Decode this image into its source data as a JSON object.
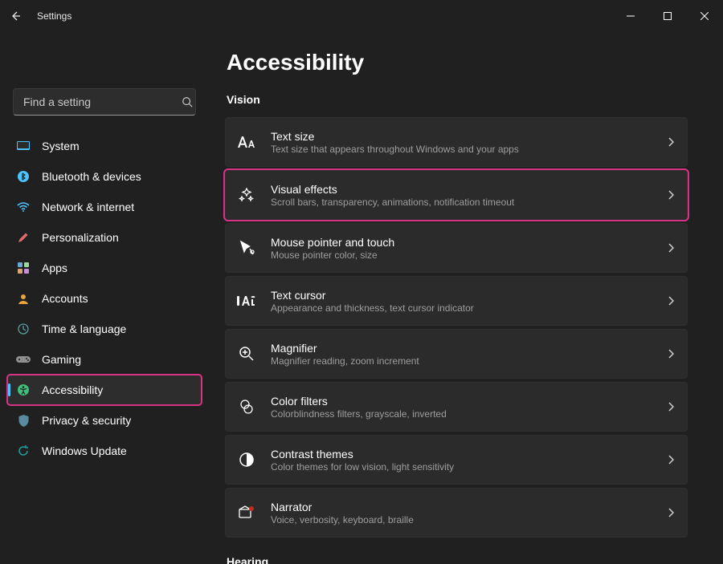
{
  "window": {
    "title": "Settings"
  },
  "search": {
    "placeholder": "Find a setting"
  },
  "sidebar": {
    "items": [
      {
        "id": "system",
        "label": "System",
        "icon_name": "system-icon",
        "icon_color": "#4cc2ff",
        "active": false,
        "highlight": false
      },
      {
        "id": "bluetooth",
        "label": "Bluetooth & devices",
        "icon_name": "bluetooth-icon",
        "icon_color": "#4cc2ff",
        "active": false,
        "highlight": false
      },
      {
        "id": "network",
        "label": "Network & internet",
        "icon_name": "wifi-icon",
        "icon_color": "#4cc2ff",
        "active": false,
        "highlight": false
      },
      {
        "id": "personalization",
        "label": "Personalization",
        "icon_name": "pen-icon",
        "icon_color": "#e06b6b",
        "active": false,
        "highlight": false
      },
      {
        "id": "apps",
        "label": "Apps",
        "icon_name": "apps-icon",
        "icon_color": "#8f8f8f",
        "active": false,
        "highlight": false
      },
      {
        "id": "accounts",
        "label": "Accounts",
        "icon_name": "accounts-icon",
        "icon_color": "#e8a33d",
        "active": false,
        "highlight": false
      },
      {
        "id": "time-language",
        "label": "Time & language",
        "icon_name": "time-language-icon",
        "icon_color": "#5aa0a0",
        "active": false,
        "highlight": false
      },
      {
        "id": "gaming",
        "label": "Gaming",
        "icon_name": "gaming-icon",
        "icon_color": "#8f8f8f",
        "active": false,
        "highlight": false
      },
      {
        "id": "accessibility",
        "label": "Accessibility",
        "icon_name": "accessibility-icon",
        "icon_color": "#3fbf7a",
        "active": true,
        "highlight": true
      },
      {
        "id": "privacy",
        "label": "Privacy & security",
        "icon_name": "shield-icon",
        "icon_color": "#5a8aa0",
        "active": false,
        "highlight": false
      },
      {
        "id": "windows-update",
        "label": "Windows Update",
        "icon_name": "windows-update-icon",
        "icon_color": "#1aa0a0",
        "active": false,
        "highlight": false
      }
    ]
  },
  "page": {
    "title": "Accessibility",
    "section1": {
      "title": "Vision"
    },
    "section2": {
      "title": "Hearing"
    },
    "cards": [
      {
        "id": "text-size",
        "icon_name": "text-size-icon",
        "title": "Text size",
        "subtitle": "Text size that appears throughout Windows and your apps",
        "highlight": false
      },
      {
        "id": "visual-effects",
        "icon_name": "visual-effects-icon",
        "title": "Visual effects",
        "subtitle": "Scroll bars, transparency, animations, notification timeout",
        "highlight": true
      },
      {
        "id": "mouse-pointer",
        "icon_name": "mouse-pointer-icon",
        "title": "Mouse pointer and touch",
        "subtitle": "Mouse pointer color, size",
        "highlight": false
      },
      {
        "id": "text-cursor",
        "icon_name": "text-cursor-icon",
        "title": "Text cursor",
        "subtitle": "Appearance and thickness, text cursor indicator",
        "highlight": false
      },
      {
        "id": "magnifier",
        "icon_name": "magnifier-icon",
        "title": "Magnifier",
        "subtitle": "Magnifier reading, zoom increment",
        "highlight": false
      },
      {
        "id": "color-filters",
        "icon_name": "color-filters-icon",
        "title": "Color filters",
        "subtitle": "Colorblindness filters, grayscale, inverted",
        "highlight": false
      },
      {
        "id": "contrast-themes",
        "icon_name": "contrast-icon",
        "title": "Contrast themes",
        "subtitle": "Color themes for low vision, light sensitivity",
        "highlight": false
      },
      {
        "id": "narrator",
        "icon_name": "narrator-icon",
        "title": "Narrator",
        "subtitle": "Voice, verbosity, keyboard, braille",
        "highlight": false
      }
    ]
  },
  "colors": {
    "highlight": "#d63384",
    "accent": "#4cc2ff",
    "bg": "#202020",
    "card": "#2b2b2b"
  }
}
